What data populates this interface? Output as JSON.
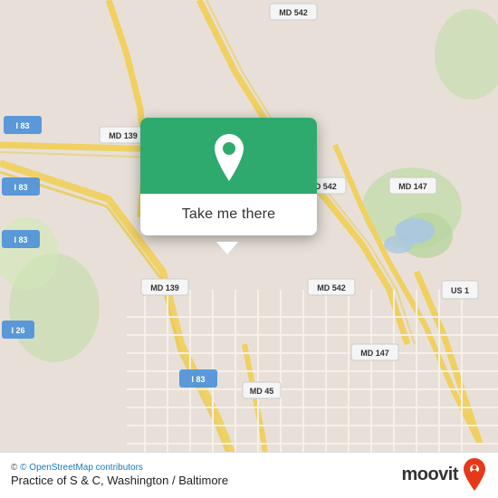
{
  "map": {
    "title": "Practice of S & C, Washington / Baltimore",
    "background_color": "#e8e0d8"
  },
  "popup": {
    "button_label": "Take me there",
    "background_color": "#2eaa6e",
    "pin_color": "white"
  },
  "bottom_bar": {
    "osm_credit": "© OpenStreetMap contributors",
    "location_name": "Practice of S & C, Washington / Baltimore",
    "moovit_label": "moovit"
  },
  "road_labels": [
    "MD 139",
    "MD 542",
    "I 83",
    "MD 147",
    "US 1",
    "MD 45",
    "I 26",
    "MD 139"
  ]
}
